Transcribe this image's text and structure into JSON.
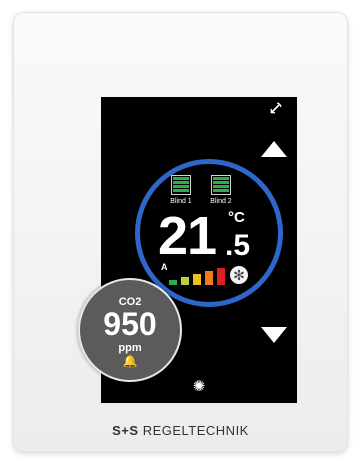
{
  "device": {
    "brand_mark": "S+S",
    "brand_name": "REGELTECHNIK"
  },
  "screen": {
    "blinds": [
      {
        "label": "Blind 1",
        "icon": "blind-icon",
        "color": "#2eae4b"
      },
      {
        "label": "Blind 2",
        "icon": "blind-icon",
        "color": "#2eae4b"
      }
    ],
    "temperature": {
      "integer": "21",
      "decimal": ".5",
      "unit": "°C"
    },
    "fan": {
      "mode": "A",
      "levels": 5,
      "active_levels": 5,
      "colors": [
        "#2eae4b",
        "#b8d23a",
        "#f0c020",
        "#f07a20",
        "#e02020"
      ],
      "icon": "fan-icon"
    },
    "co2": {
      "label": "CO2",
      "value": "950",
      "unit": "ppm",
      "alarm_icon": "bell-icon"
    },
    "icons": {
      "up": "arrow-up-icon",
      "down": "arrow-down-icon",
      "connectivity": "signal-icon",
      "brightness": "sun-icon"
    },
    "accent": "#2e67c9"
  }
}
